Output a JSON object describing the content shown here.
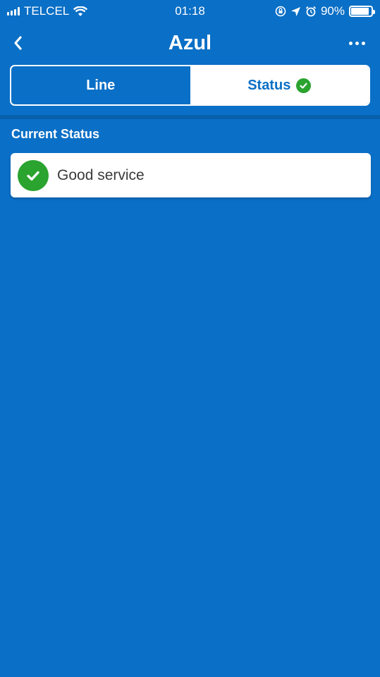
{
  "status_bar": {
    "carrier": "TELCEL",
    "time": "01:18",
    "battery": "90%",
    "battery_level": 0.9
  },
  "nav": {
    "title": "Azul",
    "back_icon": "chevron-left-icon",
    "more_icon": "more-horizontal-icon"
  },
  "tabs": [
    {
      "label": "Line",
      "selected": false
    },
    {
      "label": "Status",
      "selected": true,
      "icon": "check-circle-icon"
    }
  ],
  "section": {
    "label": "Current Status"
  },
  "status_card": {
    "text": "Good service",
    "icon": "check-circle-icon",
    "icon_color": "#2aa32f"
  },
  "colors": {
    "background": "#0a6fc6",
    "surface": "#ffffff",
    "success": "#2aa32f"
  }
}
